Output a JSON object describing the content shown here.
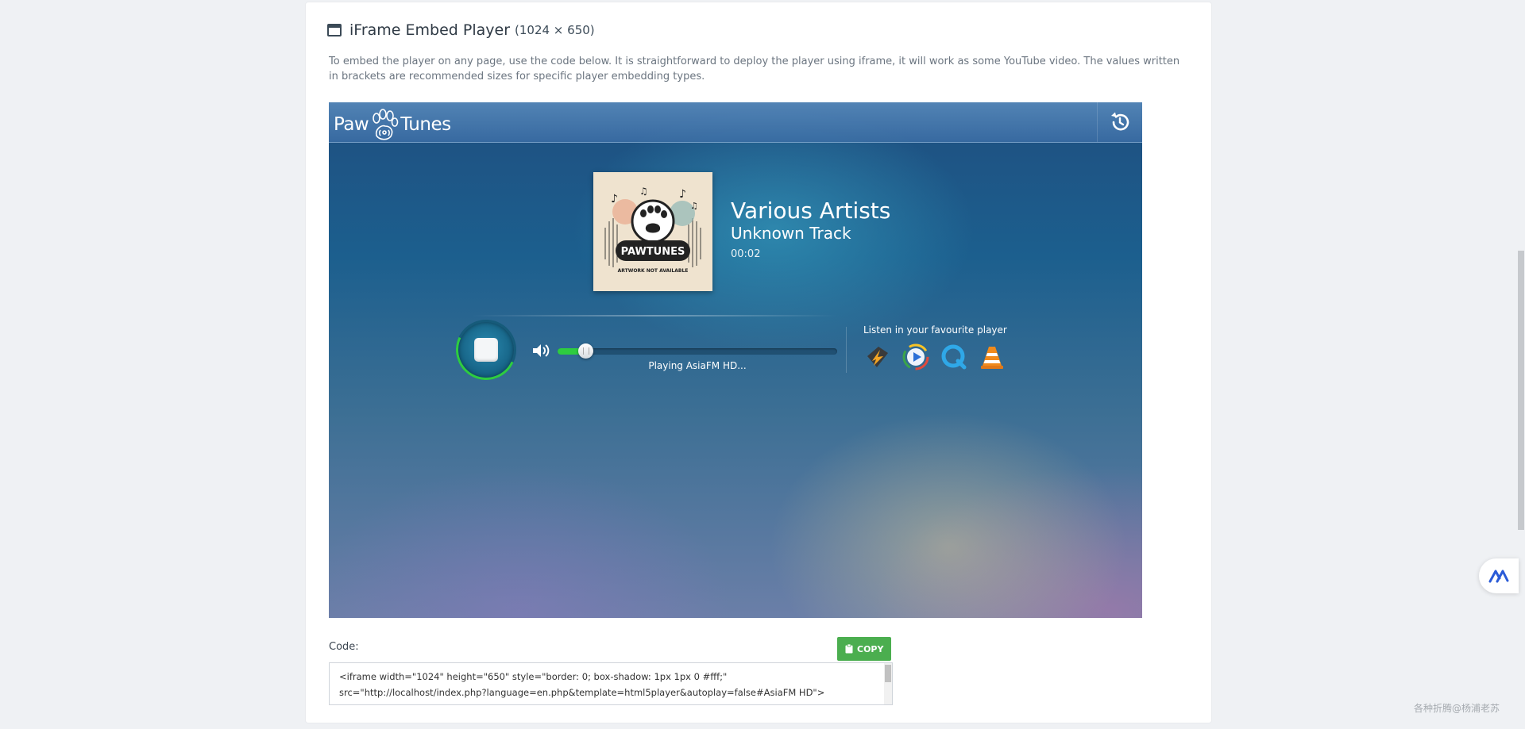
{
  "card": {
    "title": "iFrame Embed Player",
    "dimensions": "(1024 × 650)",
    "description": "To embed the player on any page, use the code below. It is straightforward to deploy the player using iframe, it will work as some YouTube video. The values written in brackets are recommended sizes for specific player embedding types."
  },
  "player": {
    "logo_left": "Paw",
    "logo_right": "Tunes",
    "artist": "Various Artists",
    "track": "Unknown Track",
    "time": "00:02",
    "status": "Playing AsiaFM HD...",
    "volume_level": 0.1,
    "listen_label": "Listen in your favourite player",
    "artwork_text": "PAWTUNES",
    "artwork_subtext": "ARTWORK NOT AVAILABLE",
    "external_players": [
      "winamp-icon",
      "windows-media-player-icon",
      "quicktime-icon",
      "vlc-icon"
    ],
    "accent_color": "#2ecc40"
  },
  "code": {
    "label": "Code:",
    "copy_label": "COPY",
    "snippet": "<iframe width=\"1024\" height=\"650\" style=\"border: 0; box-shadow: 1px 1px 0  #fff;\" src=\"http://localhost/index.php?language=en.php&template=html5player&autoplay=false#AsiaFM HD\"></iframe>"
  },
  "watermark": "各种折腾@杨浦老苏"
}
